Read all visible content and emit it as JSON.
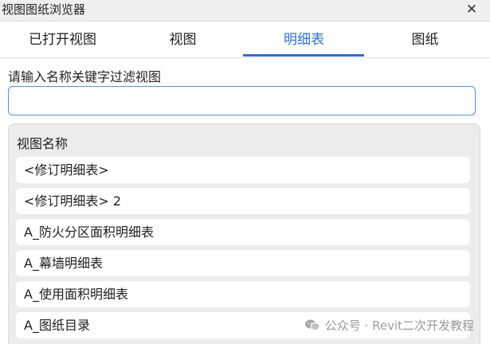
{
  "window": {
    "title": "视图图纸浏览器",
    "close_icon": "close-icon"
  },
  "tabs": [
    {
      "label": "已打开视图",
      "active": false
    },
    {
      "label": "视图",
      "active": false
    },
    {
      "label": "明细表",
      "active": true
    },
    {
      "label": "图纸",
      "active": false
    }
  ],
  "filter": {
    "label": "请输入名称关键字过滤视图",
    "value": "",
    "placeholder": ""
  },
  "list": {
    "header": "视图名称",
    "items": [
      "<修订明细表>",
      "<修订明细表> 2",
      "A_防火分区面积明细表",
      "A_幕墙明细表",
      "A_使用面积明细表",
      "A_图纸目录"
    ]
  },
  "watermark": {
    "text": "公众号 · Revit二次开发教程",
    "icon": "wechat-icon"
  },
  "colors": {
    "accent": "#2f6fd0",
    "input_border": "#5b8fd9",
    "panel_bg": "#ececec"
  }
}
